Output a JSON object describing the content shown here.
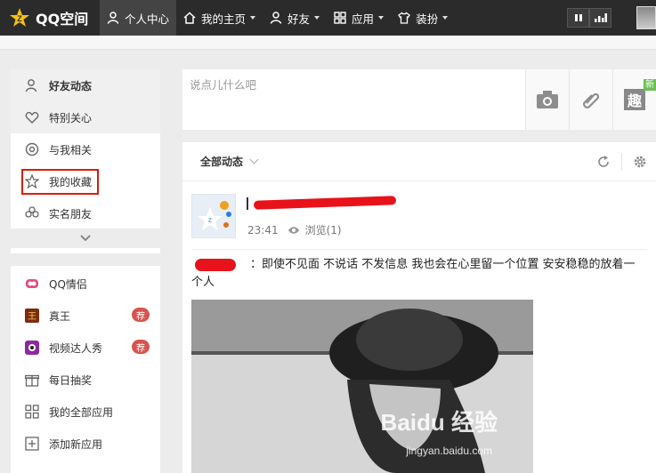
{
  "brand": {
    "name": "QQ空间"
  },
  "nav": [
    {
      "label": "个人中心",
      "active": true,
      "has_caret": false,
      "icon": "person-icon"
    },
    {
      "label": "我的主页",
      "active": false,
      "has_caret": true,
      "icon": "home-icon"
    },
    {
      "label": "好友",
      "active": false,
      "has_caret": true,
      "icon": "friends-icon"
    },
    {
      "label": "应用",
      "active": false,
      "has_caret": true,
      "icon": "apps-icon"
    },
    {
      "label": "装扮",
      "active": false,
      "has_caret": true,
      "icon": "shirt-icon"
    }
  ],
  "sidebar_main": [
    {
      "label": "好友动态",
      "icon": "person-outline-icon",
      "selected": true
    },
    {
      "label": "特别关心",
      "icon": "heart-icon",
      "selected": false
    },
    {
      "label": "与我相关",
      "icon": "at-icon",
      "selected": false
    },
    {
      "label": "我的收藏",
      "icon": "star-outline-icon",
      "selected": false,
      "highlighted": true
    },
    {
      "label": "实名朋友",
      "icon": "flower-icon",
      "selected": false
    }
  ],
  "sidebar_apps": [
    {
      "label": "QQ情侣",
      "icon": "couple-icon",
      "badge": ""
    },
    {
      "label": "真王",
      "icon": "game-zhenwang-icon",
      "badge": "荐"
    },
    {
      "label": "视频达人秀",
      "icon": "video-show-icon",
      "badge": "荐"
    },
    {
      "label": "每日抽奖",
      "icon": "gift-icon",
      "badge": ""
    },
    {
      "label": "我的全部应用",
      "icon": "grid-icon",
      "badge": ""
    },
    {
      "label": "添加新应用",
      "icon": "plus-box-icon",
      "badge": ""
    }
  ],
  "composer": {
    "placeholder": "说点儿什么吧",
    "fun_label": "趣",
    "new_tag": "新"
  },
  "feed": {
    "title": "全部动态",
    "post": {
      "time": "23:41",
      "views": "浏览(1)",
      "text": "：即使不见面 不说话 不发信息 我也会在心里留一个位置 安安稳稳的放着一个人"
    }
  },
  "watermark": {
    "main": "Baidu 经验",
    "sub": "jingyan.baidu.com"
  },
  "colors": {
    "topbar": "#2b2b2b",
    "accent_red": "#d81e06",
    "badge": "#d9534f",
    "new_tag": "#6cbf55"
  }
}
